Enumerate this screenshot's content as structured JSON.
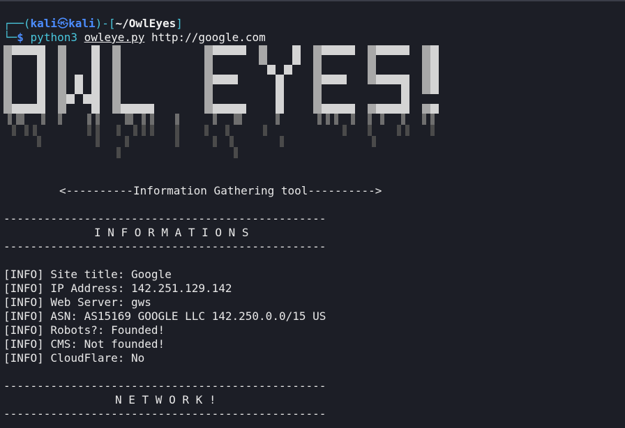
{
  "prompt": {
    "user": "kali",
    "host": "kali",
    "path": "~/OwlEyes",
    "symbol": "$",
    "command": "python3",
    "script": "owleye.py",
    "argument": "http://google.com"
  },
  "banner": {
    "text": "OWL EYES!",
    "colors": {
      "light": "#d4d4d4",
      "mid": "#a8a8a8",
      "dark": "#6e6e6e",
      "darker": "#4a4a4a"
    }
  },
  "subtitle": "<----------Information Gathering tool---------->",
  "divider": "------------------------------------------------",
  "sections": {
    "info_title": "I N F O R M A T I O N S",
    "network_title": "N E T W O R K !"
  },
  "info_lines": [
    "[INFO] Site title: Google",
    "[INFO] IP Address: 142.251.129.142",
    "[INFO] Web Server: gws",
    "[INFO] ASN: AS15169 GOOGLE LLC 142.250.0.0/15 US",
    "[INFO] Robots?: Founded!",
    "[INFO] CMS: Not founded!",
    "[INFO] CloudFlare: No"
  ],
  "colors": {
    "background": "#1c1e26",
    "prompt_blue": "#4c8dff",
    "prompt_cyan": "#49c6dc",
    "text": "#e8e8e8"
  }
}
